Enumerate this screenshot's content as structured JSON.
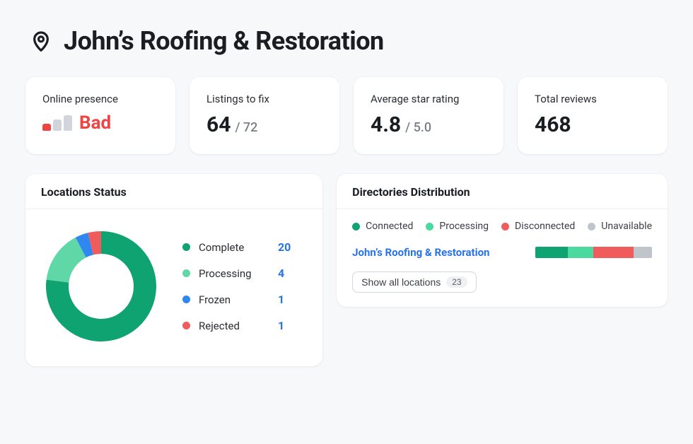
{
  "header": {
    "title": "John’s Roofing & Restoration"
  },
  "metrics": {
    "presence": {
      "label": "Online presence",
      "status": "Bad"
    },
    "listings": {
      "label": "Listings to fix",
      "value": "64",
      "suffix": "/ 72"
    },
    "rating": {
      "label": "Average star rating",
      "value": "4.8",
      "suffix": "/ 5.0"
    },
    "reviews": {
      "label": "Total reviews",
      "value": "468"
    }
  },
  "locations": {
    "title": "Locations Status",
    "items": [
      {
        "label": "Complete",
        "value": "20",
        "color": "#0ea371"
      },
      {
        "label": "Processing",
        "value": "4",
        "color": "#5fd7a6"
      },
      {
        "label": "Frozen",
        "value": "1",
        "color": "#2f88f0"
      },
      {
        "label": "Rejected",
        "value": "1",
        "color": "#f05b5b"
      }
    ]
  },
  "distribution": {
    "title": "Directories Distribution",
    "legend": [
      {
        "label": "Connected",
        "color": "#0ea371"
      },
      {
        "label": "Processing",
        "color": "#4cd9a0"
      },
      {
        "label": "Disconnected",
        "color": "#f05b5b"
      },
      {
        "label": "Unavailable",
        "color": "#c0c4cb"
      }
    ],
    "row_name": "John’s Roofing & Restoration",
    "segments": [
      {
        "key": "connected",
        "pct": 28
      },
      {
        "key": "processing",
        "pct": 22
      },
      {
        "key": "disconnected",
        "pct": 34
      },
      {
        "key": "unavailable",
        "pct": 16
      }
    ],
    "show_all_label": "Show all locations",
    "show_all_count": "23"
  },
  "chart_data": {
    "type": "pie",
    "title": "Locations Status",
    "categories": [
      "Complete",
      "Processing",
      "Frozen",
      "Rejected"
    ],
    "values": [
      20,
      4,
      1,
      1
    ],
    "colors": [
      "#0ea371",
      "#5fd7a6",
      "#2f88f0",
      "#f05b5b"
    ]
  }
}
